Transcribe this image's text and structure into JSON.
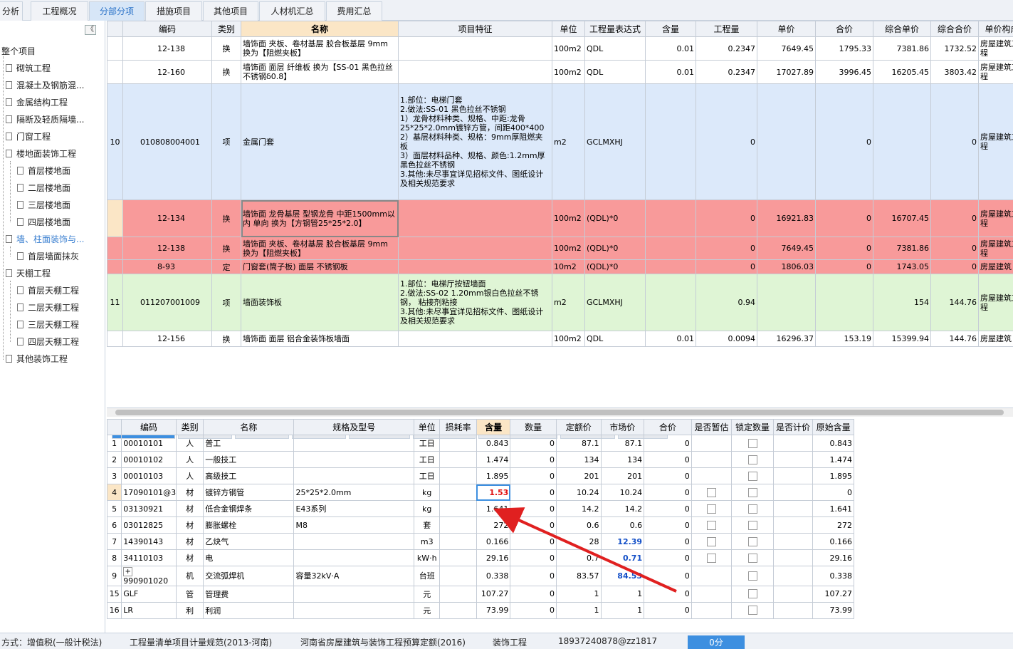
{
  "top_tabs": [
    "分析",
    "工程概况",
    "分部分项",
    "措施项目",
    "其他项目",
    "人材机汇总",
    "费用汇总"
  ],
  "tree": {
    "collapse": "《",
    "items": [
      "整个项目",
      "砌筑工程",
      "混凝土及钢筋混...",
      "金属结构工程",
      "隔断及轻质隔墙...",
      "门窗工程",
      "楼地面装饰工程",
      "首层楼地面",
      "二层楼地面",
      "三层楼地面",
      "四层楼地面",
      "墙、柱面装饰与...",
      "首层墙面抹灰",
      "天棚工程",
      "首层天棚工程",
      "二层天棚工程",
      "三层天棚工程",
      "四层天棚工程",
      "其他装饰工程"
    ]
  },
  "upper": {
    "headers": [
      "",
      "编码",
      "类别",
      "名称",
      "项目特征",
      "单位",
      "工程量表达式",
      "含量",
      "工程量",
      "单价",
      "合价",
      "综合单价",
      "综合合价",
      "单价构成"
    ],
    "rows": [
      [
        "",
        "12-138",
        "换",
        "墙饰面 夹板、卷材基层 胶合板基层 9mm 换为【阻燃夹板】",
        "",
        "100m2",
        "QDL",
        "0.01",
        "0.2347",
        "7649.45",
        "1795.33",
        "7381.86",
        "1732.52",
        "房屋建筑工程"
      ],
      [
        "",
        "12-160",
        "换",
        "墙饰面 面层 纤维板 换为【SS-01 黑色拉丝不锈钢δ0.8】",
        "",
        "100m2",
        "QDL",
        "0.01",
        "0.2347",
        "17027.89",
        "3996.45",
        "16205.45",
        "3803.42",
        "房屋建筑工程"
      ],
      [
        "10",
        "010808004001",
        "项",
        "金属门套",
        "1.部位：电梯门套\n2.做法:SS-01 黑色拉丝不锈钢\n1）龙骨材料种类、规格、中距:龙骨25*25*2.0mm镀锌方管，间距400*400\n2）基层材料种类、规格：9mm厚阻燃夹板\n3）面层材料品种、规格、颜色:1.2mm厚黑色拉丝不锈钢\n3.其他:未尽事宜详见招标文件、图纸设计及相关规范要求",
        "m2",
        "GCLMXHJ",
        "",
        "0",
        "",
        "0",
        "",
        "0",
        "房屋建筑工程"
      ],
      [
        "",
        "12-134",
        "换",
        "墙饰面 龙骨基层 型钢龙骨 中距1500mm以内 单向 换为【方钢管25*25*2.0】",
        "",
        "100m2",
        "(QDL)*0",
        "",
        "0",
        "16921.83",
        "0",
        "16707.45",
        "0",
        "房屋建筑工程"
      ],
      [
        "",
        "12-138",
        "换",
        "墙饰面 夹板、卷材基层 胶合板基层 9mm 换为【阻燃夹板】",
        "",
        "100m2",
        "(QDL)*0",
        "",
        "0",
        "7649.45",
        "0",
        "7381.86",
        "0",
        "房屋建筑工程"
      ],
      [
        "",
        "8-93",
        "定",
        "门窗套(筒子板) 面层 不锈钢板",
        "",
        "10m2",
        "(QDL)*0",
        "",
        "0",
        "1806.03",
        "0",
        "1743.05",
        "0",
        "房屋建筑"
      ],
      [
        "11",
        "011207001009",
        "项",
        "墙面装饰板",
        "1.部位：电梯厅按钮墙面\n2.做法:SS-02 1.20mm银白色拉丝不锈钢， 粘接剂粘接\n3.其他:未尽事宜详见招标文件、图纸设计及相关规范要求",
        "m2",
        "GCLMXHJ",
        "",
        "0.94",
        "",
        "",
        "154",
        "144.76",
        "房屋建筑工程"
      ],
      [
        "",
        "12-156",
        "换",
        "墙饰面 面层 铝合金装饰板墙面",
        "",
        "100m2",
        "QDL",
        "0.01",
        "0.0094",
        "16296.37",
        "153.19",
        "15399.94",
        "144.76",
        "房屋建筑"
      ]
    ]
  },
  "lower_tabs": [
    "工料机显示",
    "单价构成",
    "标准换算",
    "换算信息",
    "特征及内容",
    "工程量明细",
    "反查图形工程量",
    "说明信息",
    "组价方案"
  ],
  "lower": {
    "headers": [
      "",
      "编码",
      "类别",
      "名称",
      "规格及型号",
      "单位",
      "损耗率",
      "含量",
      "数量",
      "定额价",
      "市场价",
      "合价",
      "是否暂估",
      "锁定数量",
      "是否计价",
      "原始含量"
    ],
    "rows": [
      [
        "1",
        "00010101",
        "人",
        "普工",
        "",
        "工日",
        "",
        "0.843",
        "0",
        "87.1",
        "87.1",
        "0",
        "",
        "",
        "",
        "0.843"
      ],
      [
        "2",
        "00010102",
        "人",
        "一般技工",
        "",
        "工日",
        "",
        "1.474",
        "0",
        "134",
        "134",
        "0",
        "",
        "",
        "",
        "1.474"
      ],
      [
        "3",
        "00010103",
        "人",
        "高级技工",
        "",
        "工日",
        "",
        "1.895",
        "0",
        "201",
        "201",
        "0",
        "",
        "",
        "",
        "1.895"
      ],
      [
        "4",
        "17090101@3",
        "材",
        "镀锌方钢管",
        "25*25*2.0mm",
        "kg",
        "",
        "1.53",
        "0",
        "10.24",
        "10.24",
        "0",
        "",
        "",
        "",
        "0"
      ],
      [
        "5",
        "03130921",
        "材",
        "低合金钢焊条",
        "E43系列",
        "kg",
        "",
        "1.641",
        "0",
        "14.2",
        "14.2",
        "0",
        "",
        "",
        "",
        "1.641"
      ],
      [
        "6",
        "03012825",
        "材",
        "膨胀螺栓",
        "M8",
        "套",
        "",
        "272",
        "0",
        "0.6",
        "0.6",
        "0",
        "",
        "",
        "",
        "272"
      ],
      [
        "7",
        "14390143",
        "材",
        "乙炔气",
        "",
        "m3",
        "",
        "0.166",
        "0",
        "28",
        "12.39",
        "0",
        "",
        "",
        "",
        "0.166"
      ],
      [
        "8",
        "34110103",
        "材",
        "电",
        "",
        "kW·h",
        "",
        "29.16",
        "0",
        "0.7",
        "0.71",
        "0",
        "",
        "",
        "",
        "29.16"
      ],
      [
        "9",
        "990901020",
        "机",
        "交流弧焊机",
        "容量32kV·A",
        "台班",
        "",
        "0.338",
        "0",
        "83.57",
        "84.53",
        "0",
        "",
        "",
        "",
        "0.338"
      ],
      [
        "15",
        "GLF",
        "管",
        "管理费",
        "",
        "元",
        "",
        "107.27",
        "0",
        "1",
        "1",
        "0",
        "",
        "",
        "",
        "107.27"
      ],
      [
        "16",
        "LR",
        "利",
        "利润",
        "",
        "元",
        "",
        "73.99",
        "0",
        "1",
        "1",
        "0",
        "",
        "",
        "",
        "73.99"
      ]
    ]
  },
  "status": [
    "方式：增值税(一般计税法)",
    "工程量清单项目计量规范(2013-河南)",
    "河南省房屋建筑与装饰工程预算定额(2016)",
    "装饰工程",
    "18937240878@zz1817",
    "0分"
  ],
  "colors": {
    "accent": "#3d8fe0",
    "row_blue": "#dce9fa",
    "row_red": "#f89a9a",
    "row_green": "#dff5d5",
    "arrow": "#e02020"
  }
}
